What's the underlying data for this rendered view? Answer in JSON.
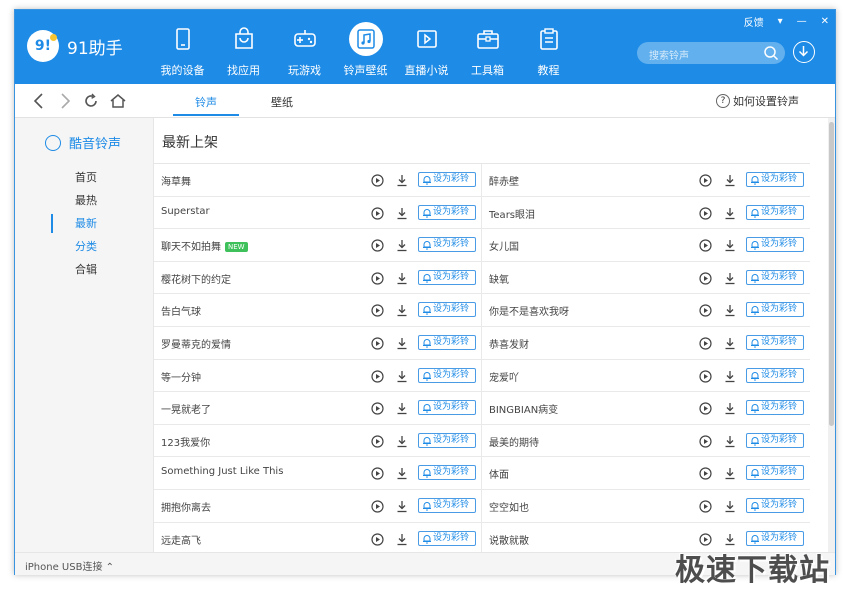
{
  "app": {
    "name": "91助手",
    "logo_text": "9!"
  },
  "window_controls": {
    "feedback": "反馈",
    "menu": "▾",
    "minimize": "—",
    "close": "✕"
  },
  "nav": [
    {
      "label": "我的设备",
      "icon": "device-icon"
    },
    {
      "label": "找应用",
      "icon": "bag-icon"
    },
    {
      "label": "玩游戏",
      "icon": "gamepad-icon"
    },
    {
      "label": "铃声壁纸",
      "icon": "music-note-icon",
      "active": true
    },
    {
      "label": "直播小说",
      "icon": "play-screen-icon"
    },
    {
      "label": "工具箱",
      "icon": "toolbox-icon"
    },
    {
      "label": "教程",
      "icon": "clipboard-icon"
    }
  ],
  "search": {
    "placeholder": "搜索铃声"
  },
  "tabs": [
    {
      "label": "铃声",
      "active": true
    },
    {
      "label": "壁纸"
    }
  ],
  "help": {
    "label": "如何设置铃声",
    "icon": "?"
  },
  "sidebar": {
    "title": "酷音铃声",
    "items": [
      {
        "label": "首页"
      },
      {
        "label": "最热"
      },
      {
        "label": "最新",
        "active": true
      },
      {
        "label": "分类",
        "link": true
      },
      {
        "label": "合辑"
      }
    ]
  },
  "main": {
    "section_title": "最新上架",
    "set_ring_label": "设为彩铃",
    "new_badge": "NEW",
    "rows": [
      [
        "海草舞",
        "醉赤壁"
      ],
      [
        "Superstar",
        "Tears眼泪"
      ],
      [
        "聊天不如拍舞",
        "女儿国"
      ],
      [
        "樱花树下的约定",
        "缺氧"
      ],
      [
        "告白气球",
        "你是不是喜欢我呀"
      ],
      [
        "罗曼蒂克的爱情",
        "恭喜发财"
      ],
      [
        "等一分钟",
        "宠爱吖"
      ],
      [
        "一晃就老了",
        "BINGBIAN病变"
      ],
      [
        "123我爱你",
        "最美的期待"
      ],
      [
        "Something Just Like This",
        "体面"
      ],
      [
        "拥抱你离去",
        "空空如也"
      ],
      [
        "远走高飞",
        "说散就散"
      ]
    ]
  },
  "status": {
    "device": "iPhone  USB连接 ⌃"
  },
  "watermark": "极速下载站",
  "colors": {
    "brand": "#1e8be6",
    "new_badge": "#3ec05a"
  }
}
